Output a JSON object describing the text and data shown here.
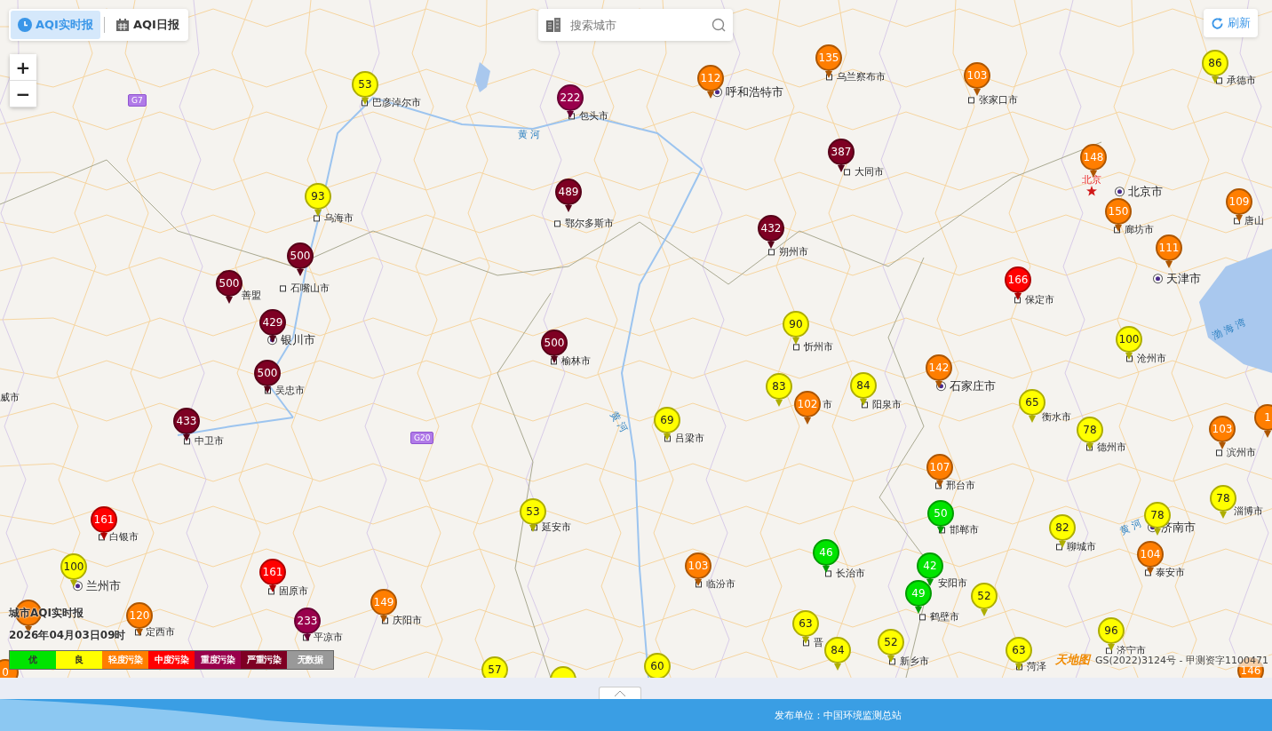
{
  "mode_tabs": [
    {
      "label": "AQI实时报",
      "selected": true
    },
    {
      "label": "AQI日报",
      "selected": false
    }
  ],
  "search": {
    "placeholder": "搜索城市"
  },
  "refresh_button": {
    "label": "刷新"
  },
  "zoom": {
    "in": "+",
    "out": "−"
  },
  "markers": [
    {
      "aqi": "135",
      "color": "#ff7e00"
    },
    {
      "aqi": "86",
      "color": "#ffff00"
    },
    {
      "aqi": "112",
      "color": "#ff7e00"
    },
    {
      "aqi": "103",
      "color": "#ff7e00"
    },
    {
      "aqi": "53",
      "color": "#ffff00"
    },
    {
      "aqi": "222",
      "color": "#99004c"
    },
    {
      "aqi": "387",
      "color": "#7e0023"
    },
    {
      "aqi": "148",
      "color": "#ff7e00"
    },
    {
      "aqi": "93",
      "color": "#ffff00"
    },
    {
      "aqi": "489",
      "color": "#7e0023"
    },
    {
      "aqi": "109",
      "color": "#ff7e00"
    },
    {
      "aqi": "150",
      "color": "#ff7e00"
    },
    {
      "aqi": "432",
      "color": "#7e0023"
    },
    {
      "aqi": "111",
      "color": "#ff7e00"
    },
    {
      "aqi": "500",
      "color": "#7e0023"
    },
    {
      "aqi": "500",
      "color": "#7e0023"
    },
    {
      "aqi": "166",
      "color": "#ff0000"
    },
    {
      "aqi": "429",
      "color": "#7e0023"
    },
    {
      "aqi": "90",
      "color": "#ffff00"
    },
    {
      "aqi": "500",
      "color": "#7e0023"
    },
    {
      "aqi": "100",
      "color": "#ffff00"
    },
    {
      "aqi": "500",
      "color": "#7e0023"
    },
    {
      "aqi": "142",
      "color": "#ff7e00"
    },
    {
      "aqi": "83",
      "color": "#ffff00"
    },
    {
      "aqi": "84",
      "color": "#ffff00"
    },
    {
      "aqi": "102",
      "color": "#ff7e00"
    },
    {
      "aqi": "65",
      "color": "#ffff00"
    },
    {
      "aqi": "433",
      "color": "#7e0023"
    },
    {
      "aqi": "69",
      "color": "#ffff00"
    },
    {
      "aqi": "1",
      "color": "#ff7e00"
    },
    {
      "aqi": "78",
      "color": "#ffff00"
    },
    {
      "aqi": "103",
      "color": "#ff7e00"
    },
    {
      "aqi": "107",
      "color": "#ff7e00"
    },
    {
      "aqi": "78",
      "color": "#ffff00"
    },
    {
      "aqi": "161",
      "color": "#ff0000"
    },
    {
      "aqi": "53",
      "color": "#ffff00"
    },
    {
      "aqi": "50",
      "color": "#00e400"
    },
    {
      "aqi": "78",
      "color": "#ffff00"
    },
    {
      "aqi": "82",
      "color": "#ffff00"
    },
    {
      "aqi": "46",
      "color": "#00e400"
    },
    {
      "aqi": "104",
      "color": "#ff7e00"
    },
    {
      "aqi": "100",
      "color": "#ffff00"
    },
    {
      "aqi": "161",
      "color": "#ff0000"
    },
    {
      "aqi": "103",
      "color": "#ff7e00"
    },
    {
      "aqi": "42",
      "color": "#00e400"
    },
    {
      "aqi": "49",
      "color": "#00e400"
    },
    {
      "aqi": "52",
      "color": "#ffff00"
    },
    {
      "aqi": "149",
      "color": "#ff7e00"
    },
    {
      "color": "#ff7e00"
    },
    {
      "aqi": "120",
      "color": "#ff7e00"
    },
    {
      "aqi": "233",
      "color": "#99004c"
    },
    {
      "aqi": "63",
      "color": "#ffff00"
    },
    {
      "aqi": "96",
      "color": "#ffff00"
    },
    {
      "aqi": "84",
      "color": "#ffff00"
    },
    {
      "aqi": "52",
      "color": "#ffff00"
    },
    {
      "aqi": "63",
      "color": "#ffff00"
    },
    {
      "aqi": "0",
      "color": "#ff7e00"
    },
    {
      "aqi": "57",
      "color": "#ffff00"
    },
    {
      "aqi": "60",
      "color": "#ffff00"
    },
    {
      "aqi": "146",
      "color": "#ff7e00"
    },
    {
      "color": "#ffff00"
    }
  ],
  "city_labels": [
    {
      "name": "乌兰察布市",
      "kind": "city"
    },
    {
      "name": "承德市",
      "kind": "city"
    },
    {
      "name": "巴彦淖尔市",
      "kind": "city"
    },
    {
      "name": "呼和浩特市",
      "kind": "capital"
    },
    {
      "name": "张家口市",
      "kind": "city"
    },
    {
      "name": "包头市",
      "kind": "city"
    },
    {
      "name": "大同市",
      "kind": "city"
    },
    {
      "name": "北京",
      "kind": "star"
    },
    {
      "name": "北京市",
      "kind": "capital"
    },
    {
      "name": "乌海市",
      "kind": "city"
    },
    {
      "name": "鄂尔多斯市",
      "kind": "city"
    },
    {
      "name": "廊坊市",
      "kind": "city"
    },
    {
      "name": "唐山",
      "kind": "city"
    },
    {
      "name": "朔州市",
      "kind": "city"
    },
    {
      "name": "善盟",
      "kind": "plain"
    },
    {
      "name": "石嘴山市",
      "kind": "city"
    },
    {
      "name": "天津市",
      "kind": "capital"
    },
    {
      "name": "保定市",
      "kind": "city"
    },
    {
      "name": "银川市",
      "kind": "capital"
    },
    {
      "name": "忻州市",
      "kind": "city"
    },
    {
      "name": "榆林市",
      "kind": "city"
    },
    {
      "name": "沧州市",
      "kind": "city"
    },
    {
      "name": "威市",
      "kind": "plain"
    },
    {
      "name": "吴忠市",
      "kind": "city"
    },
    {
      "name": "石家庄市",
      "kind": "capital"
    },
    {
      "name": "市",
      "kind": "plain"
    },
    {
      "name": "阳泉市",
      "kind": "city"
    },
    {
      "name": "衡水市",
      "kind": "plain"
    },
    {
      "name": "中卫市",
      "kind": "city"
    },
    {
      "name": "吕梁市",
      "kind": "city"
    },
    {
      "name": "德州市",
      "kind": "city"
    },
    {
      "name": "滨州市",
      "kind": "city"
    },
    {
      "name": "邢台市",
      "kind": "city"
    },
    {
      "name": "淄博市",
      "kind": "plain"
    },
    {
      "name": "白银市",
      "kind": "city"
    },
    {
      "name": "延安市",
      "kind": "city"
    },
    {
      "name": "邯郸市",
      "kind": "city"
    },
    {
      "name": "济南市",
      "kind": "capital"
    },
    {
      "name": "聊城市",
      "kind": "city"
    },
    {
      "name": "兰州市",
      "kind": "capital"
    },
    {
      "name": "固原市",
      "kind": "city"
    },
    {
      "name": "临汾市",
      "kind": "city"
    },
    {
      "name": "长治市",
      "kind": "city"
    },
    {
      "name": "安阳市",
      "kind": "plain"
    },
    {
      "name": "泰安市",
      "kind": "city"
    },
    {
      "name": "庆阳市",
      "kind": "city"
    },
    {
      "name": "鹤壁市",
      "kind": "city"
    },
    {
      "name": "定西市",
      "kind": "city"
    },
    {
      "name": "平凉市",
      "kind": "city"
    },
    {
      "name": "晋",
      "kind": "city"
    },
    {
      "name": "济宁市",
      "kind": "city"
    },
    {
      "name": "新乡市",
      "kind": "city"
    },
    {
      "name": "菏泽",
      "kind": "city"
    }
  ],
  "water_labels": [
    {
      "name": "黄 河",
      "kind": "flat"
    },
    {
      "name": "渤 海 湾",
      "kind": "slant"
    },
    {
      "name": "黄 河",
      "kind": "steep"
    },
    {
      "name": "黄 河",
      "kind": "slant"
    }
  ],
  "highway_shields": [
    "G7",
    "G20"
  ],
  "map_credit": {
    "logo": "天地图",
    "license": "GS(2022)3124号 - 甲测资字1100471"
  },
  "report": {
    "title": "城市AQI实时报",
    "time": "2026年04月03日09时"
  },
  "legend": [
    {
      "label": "优",
      "color": "#00e400"
    },
    {
      "label": "良",
      "color": "#ffff00"
    },
    {
      "label": "轻度污染",
      "color": "#ff7e00"
    },
    {
      "label": "中度污染",
      "color": "#ff0000"
    },
    {
      "label": "重度污染",
      "color": "#99004c"
    },
    {
      "label": "严重污染",
      "color": "#7e0023"
    },
    {
      "label": "无数据",
      "color": "#999999"
    }
  ],
  "footer": {
    "publisher": "发布单位：中国环境监测总站"
  }
}
